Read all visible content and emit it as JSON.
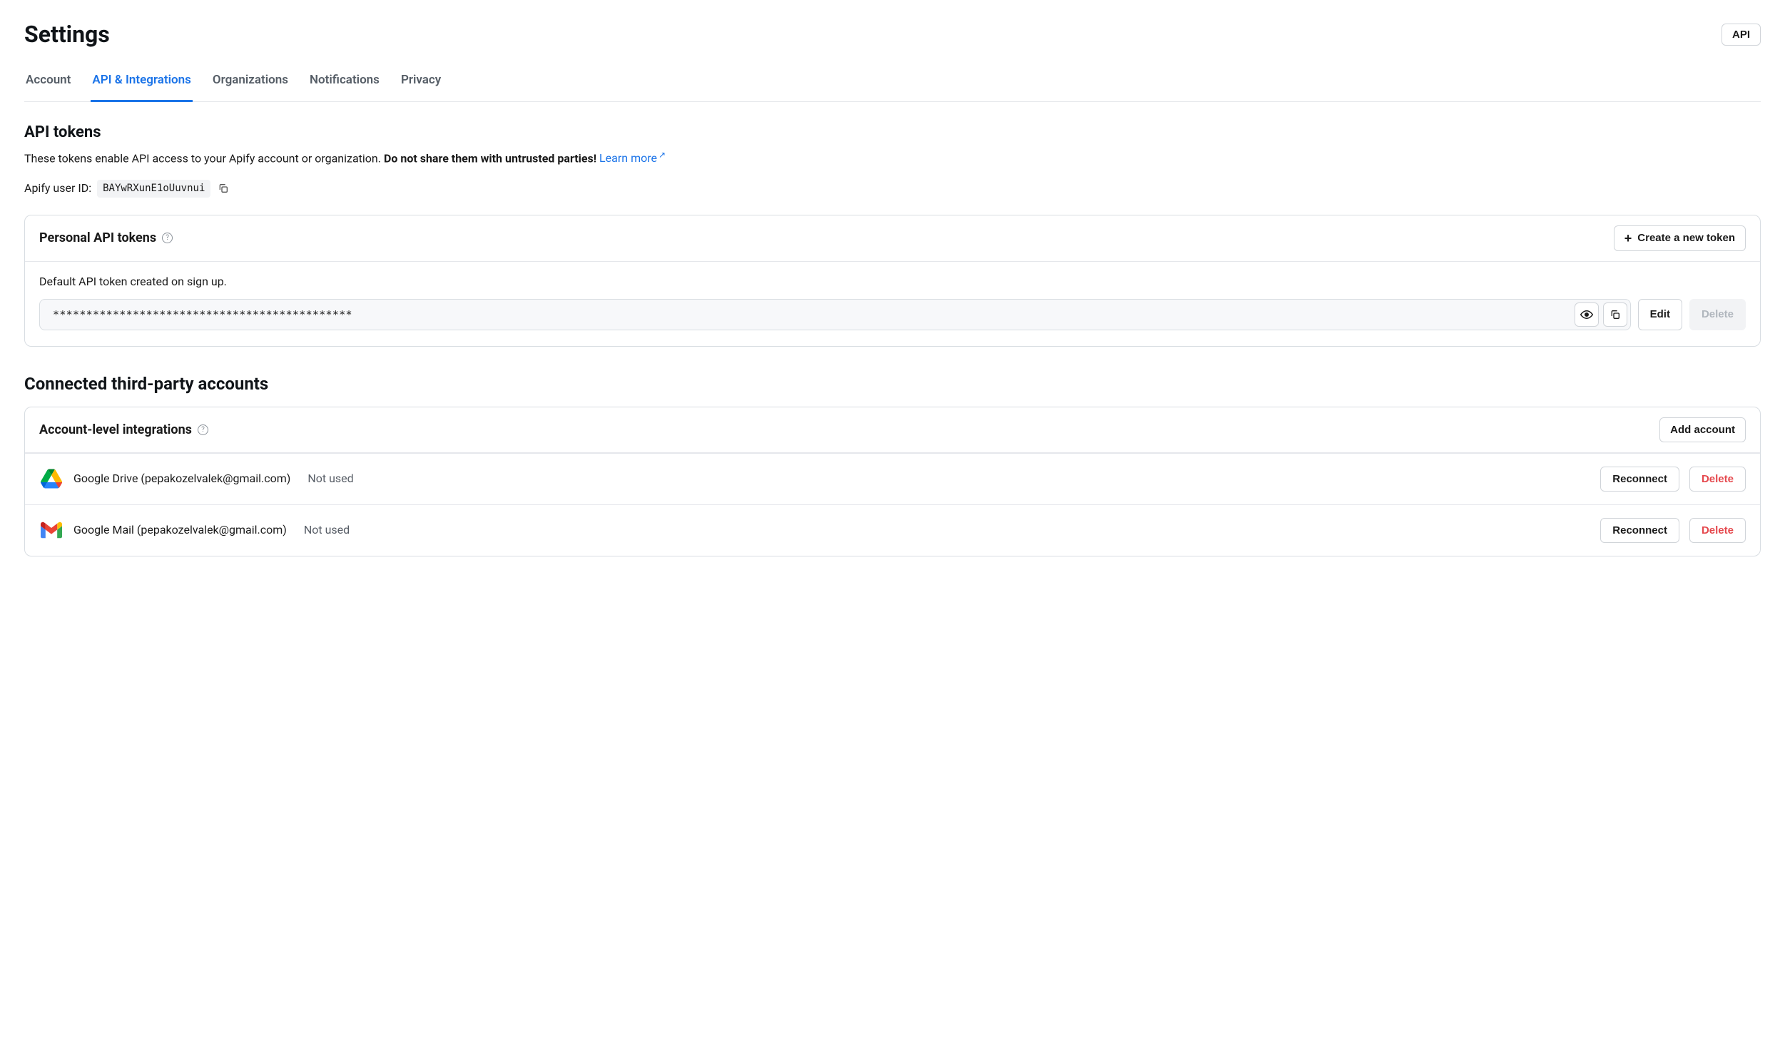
{
  "header": {
    "title": "Settings",
    "api_button": "API"
  },
  "tabs": [
    {
      "label": "Account",
      "active": false
    },
    {
      "label": "API & Integrations",
      "active": true
    },
    {
      "label": "Organizations",
      "active": false
    },
    {
      "label": "Notifications",
      "active": false
    },
    {
      "label": "Privacy",
      "active": false
    }
  ],
  "api_tokens": {
    "heading": "API tokens",
    "desc_pre": "These tokens enable API access to your Apify account or organization. ",
    "desc_strong": "Do not share them with untrusted parties!",
    "learn_more": "Learn more",
    "user_id_label": "Apify user ID:",
    "user_id_value": "BAYwRXunE1oUuvnui",
    "personal_heading": "Personal API tokens",
    "create_button": "Create a new token",
    "default_token_label": "Default API token created on sign up.",
    "token_masked": "*********************************************",
    "edit": "Edit",
    "delete": "Delete"
  },
  "connected": {
    "heading": "Connected third-party accounts",
    "card_heading": "Account-level integrations",
    "add_account": "Add account",
    "reconnect": "Reconnect",
    "delete": "Delete",
    "integrations": [
      {
        "service": "Google Drive",
        "email": "pepakozelvalek@gmail.com",
        "status": "Not used",
        "icon": "drive"
      },
      {
        "service": "Google Mail",
        "email": "pepakozelvalek@gmail.com",
        "status": "Not used",
        "icon": "gmail"
      }
    ]
  }
}
